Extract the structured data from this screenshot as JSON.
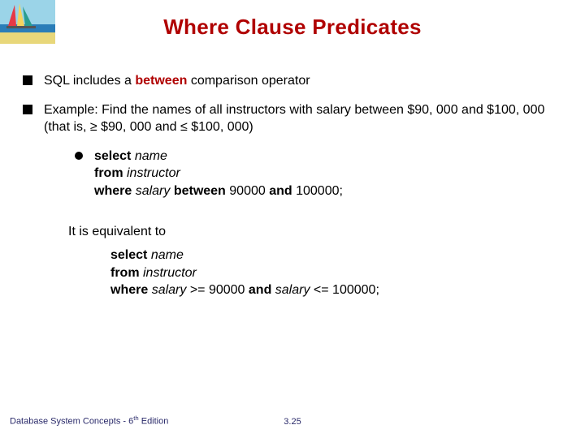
{
  "title": "Where Clause Predicates",
  "bullets": [
    {
      "prefix": "SQL includes a ",
      "keyword": "between",
      "suffix": " comparison operator"
    },
    {
      "prefix": "Example:  Find the names of all instructors with salary between $90, 000 and $100, 000 (that is, ",
      "sym1": "≥",
      "mid1": " $90, 000 and ",
      "sym2": "≤",
      "mid2": " $100, 000)"
    }
  ],
  "code1": {
    "l1a": "select ",
    "l1b": "name",
    "l2a": "from ",
    "l2b": "instructor",
    "l3a": "where ",
    "l3b": "salary ",
    "l3c": "between ",
    "l3d": "90000 ",
    "l3e": "and ",
    "l3f": "100000;"
  },
  "equiv": "It is equivalent to",
  "code2": {
    "l1a": "select  ",
    "l1b": "name",
    "l2a": "from ",
    "l2b": "instructor",
    "l3a": "where ",
    "l3b": "salary ",
    "l3c": ">= ",
    "l3d": "90000 ",
    "l3e": "and  ",
    "l3f": "salary ",
    "l3g": "<= ",
    "l3h": "100000;"
  },
  "footer": {
    "left_a": "Database System Concepts - 6",
    "left_b": " Edition",
    "center": "3.25"
  },
  "logo": {
    "sky": "#9bd4e8",
    "sea": "#2a7db8",
    "beach": "#e8d77a",
    "sail1": "#e63946",
    "sail2": "#f4d35e",
    "sail3": "#2a9d8f"
  }
}
